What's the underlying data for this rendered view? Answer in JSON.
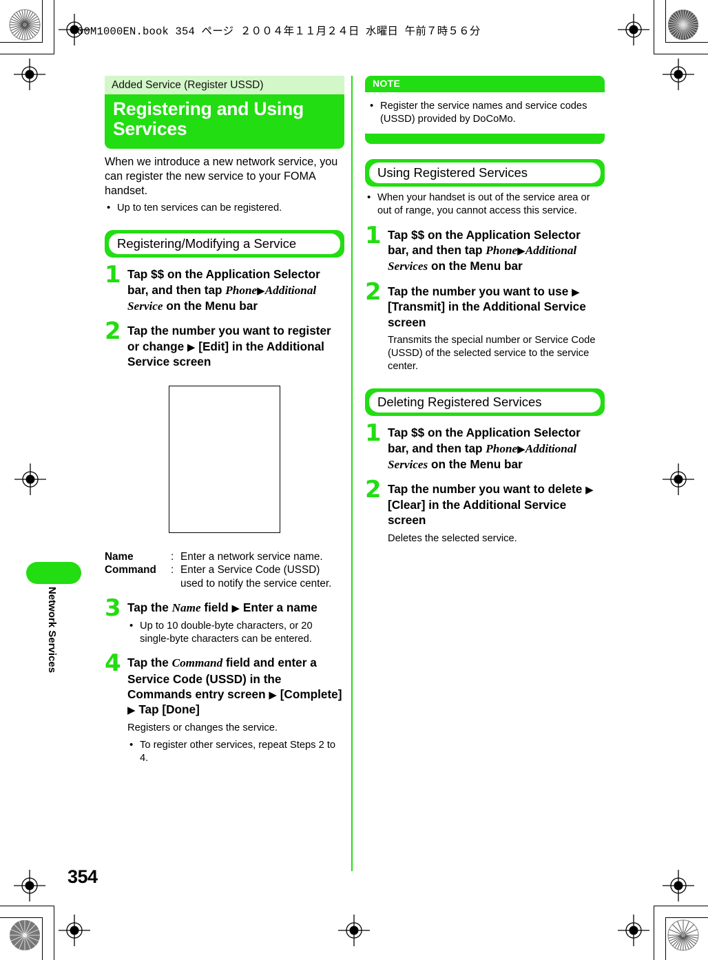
{
  "page_header": "00M1000EN.book   354 ページ   ２００４年１１月２４日   水曜日   午前７時５６分",
  "side_tab": {
    "label": "Network Services"
  },
  "page_number": "354",
  "left_column": {
    "kicker": "Added Service (Register USSD)",
    "title": "Registering and Using Services",
    "intro": "When we introduce a new network service, you can register the new service to your FOMA handset.",
    "intro_bullets": [
      "Up to ten services can be registered."
    ],
    "section": {
      "heading": "Registering/Modifying a Service"
    },
    "steps": [
      {
        "num": "1",
        "text_parts": [
          {
            "type": "bold",
            "text": "Tap $$ on the Application Selector bar, and then tap "
          },
          {
            "type": "italic",
            "text": "Phone"
          },
          {
            "type": "arrow",
            "text": "▶"
          },
          {
            "type": "italic",
            "text": "Additional Service"
          },
          {
            "type": "bold",
            "text": " on the Menu bar"
          }
        ]
      },
      {
        "num": "2",
        "text_parts": [
          {
            "type": "bold",
            "text": "Tap the number you want to register or change "
          },
          {
            "type": "arrow",
            "text": "▶"
          },
          {
            "type": "bold",
            "text": " [Edit] in the Additional Service screen"
          }
        ]
      },
      {
        "num": "3",
        "text_parts": [
          {
            "type": "bold",
            "text": "Tap the "
          },
          {
            "type": "italic",
            "text": "Name"
          },
          {
            "type": "bold",
            "text": " field "
          },
          {
            "type": "arrow",
            "text": "▶"
          },
          {
            "type": "bold",
            "text": " Enter a name"
          }
        ],
        "bullets": [
          "Up to 10 double-byte characters, or 20 single-byte characters can be entered."
        ]
      },
      {
        "num": "4",
        "text_parts": [
          {
            "type": "bold",
            "text": "Tap the "
          },
          {
            "type": "italic",
            "text": "Command"
          },
          {
            "type": "bold",
            "text": " field and enter a Service Code (USSD) in the Commands entry screen "
          },
          {
            "type": "arrow",
            "text": "▶"
          },
          {
            "type": "bold",
            "text": " [Complete] "
          },
          {
            "type": "arrow",
            "text": "▶"
          },
          {
            "type": "bold",
            "text": " Tap [Done]"
          }
        ],
        "note": "Registers or changes the service.",
        "bullets": [
          "To register other services, repeat Steps 2 to 4."
        ]
      }
    ],
    "definitions": [
      {
        "term": "Name",
        "colon": ":",
        "desc": "Enter a network service name."
      },
      {
        "term": "Command",
        "colon": ":",
        "desc": "Enter a Service Code (USSD) used to notify the service center."
      }
    ]
  },
  "right_column": {
    "note_box": {
      "label": "NOTE",
      "bullets": [
        "Register the service names and service codes (USSD) provided by DoCoMo."
      ]
    },
    "sections": [
      {
        "heading": "Using Registered Services",
        "bullets": [
          "When your handset is out of the service area or out of range, you cannot access this service."
        ],
        "steps": [
          {
            "num": "1",
            "text_parts": [
              {
                "type": "bold",
                "text": "Tap $$ on the Application Selector bar, and then tap "
              },
              {
                "type": "italic",
                "text": "Phone"
              },
              {
                "type": "arrow",
                "text": "▶"
              },
              {
                "type": "italic",
                "text": "Additional Services"
              },
              {
                "type": "bold",
                "text": " on the Menu bar"
              }
            ]
          },
          {
            "num": "2",
            "text_parts": [
              {
                "type": "bold",
                "text": "Tap the number you want to use "
              },
              {
                "type": "arrow",
                "text": "▶"
              },
              {
                "type": "bold",
                "text": " [Transmit] in the Additional Service screen"
              }
            ],
            "note": "Transmits the special number or Service Code (USSD) of the selected service to the service center."
          }
        ]
      },
      {
        "heading": "Deleting Registered Services",
        "bullets": [],
        "steps": [
          {
            "num": "1",
            "text_parts": [
              {
                "type": "bold",
                "text": "Tap $$ on the Application Selector bar, and then tap "
              },
              {
                "type": "italic",
                "text": "Phone"
              },
              {
                "type": "arrow",
                "text": "▶"
              },
              {
                "type": "italic",
                "text": "Additional Services"
              },
              {
                "type": "bold",
                "text": " on the Menu bar"
              }
            ]
          },
          {
            "num": "2",
            "text_parts": [
              {
                "type": "bold",
                "text": "Tap the number you want to delete "
              },
              {
                "type": "arrow",
                "text": "▶"
              },
              {
                "type": "bold",
                "text": " [Clear] in the Additional Service screen"
              }
            ],
            "note": "Deletes the selected service."
          }
        ]
      }
    ]
  },
  "colors": {
    "green": "#22dd11",
    "light_green": "#d3f7c8",
    "white": "#ffffff",
    "black": "#000000"
  }
}
